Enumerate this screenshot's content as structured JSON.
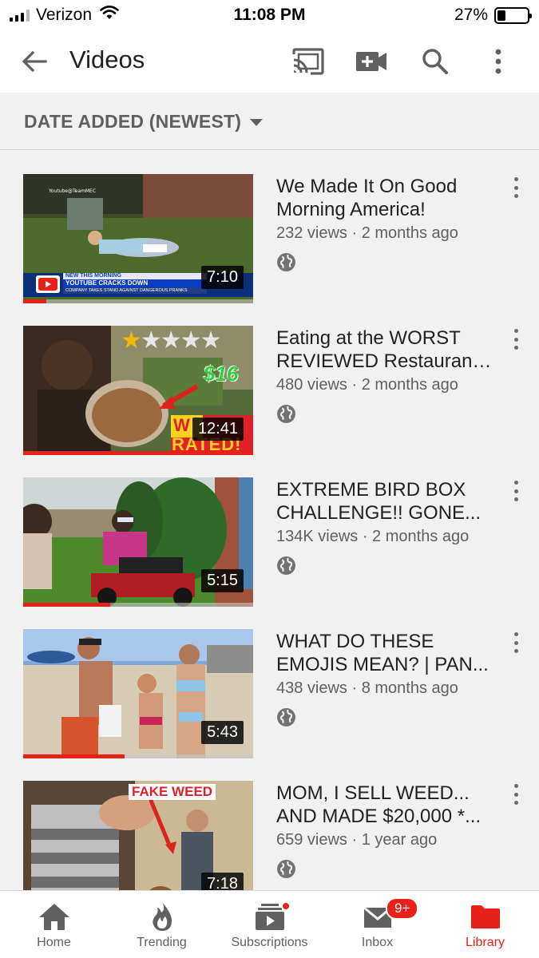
{
  "status_bar": {
    "carrier": "Verizon",
    "time": "11:08 PM",
    "battery_percent": "27%",
    "battery_level": 0.27
  },
  "app_bar": {
    "title": "Videos",
    "icons": [
      "back-arrow-icon",
      "cast-icon",
      "video-camera-add-icon",
      "search-icon",
      "more-vert-icon"
    ]
  },
  "sort": {
    "label": "DATE ADDED (NEWEST)"
  },
  "videos": [
    {
      "title_line1": "We Made It On Good",
      "title_line2": "Morning America!",
      "meta": "232 views · 2 months ago",
      "duration": "7:10",
      "progress": 0.1,
      "thumb_overlay_top": "NEW THIS MORNING",
      "thumb_overlay_headline": "YOUTUBE CRACKS DOWN",
      "thumb_overlay_sub": "COMPANY TAKES STAND AGAINST DANGEROUS PRANKS",
      "thumb_watermark": "Youtube@TeamMEC"
    },
    {
      "title_line1": "Eating at the WORST",
      "title_line2": "REVIEWED Restaurant...",
      "meta": "480 views · 2 months ago",
      "duration": "12:41",
      "progress": 1.0,
      "thumb_price": "$16",
      "thumb_banner_top": "W",
      "thumb_banner_bottom": "RATED!"
    },
    {
      "title_line1": "EXTREME BIRD BOX",
      "title_line2": "CHALLENGE!! GONE...",
      "meta": "134K views · 2 months ago",
      "duration": "5:15",
      "progress": 0.38
    },
    {
      "title_line1": "WHAT DO THESE",
      "title_line2": "EMOJIS MEAN? | PAN...",
      "meta": "438 views · 8 months ago",
      "duration": "5:43",
      "progress": 0.44
    },
    {
      "title_line1": "MOM, I SELL WEED...",
      "title_line2": "AND MADE $20,000 *...",
      "meta": "659 views · 1 year ago",
      "duration": "7:18",
      "progress": 0,
      "thumb_label": "FAKE WEED"
    }
  ],
  "bottom_nav": {
    "items": [
      {
        "label": "Home",
        "icon": "home-icon"
      },
      {
        "label": "Trending",
        "icon": "flame-icon"
      },
      {
        "label": "Subscriptions",
        "icon": "subscriptions-icon"
      },
      {
        "label": "Inbox",
        "icon": "inbox-icon",
        "badge": "9+"
      },
      {
        "label": "Library",
        "icon": "library-folder-icon",
        "active": true
      }
    ]
  },
  "colors": {
    "accent": "#e62117",
    "background": "#f1f1f1",
    "text_primary": "#212121",
    "text_secondary": "#606060"
  }
}
